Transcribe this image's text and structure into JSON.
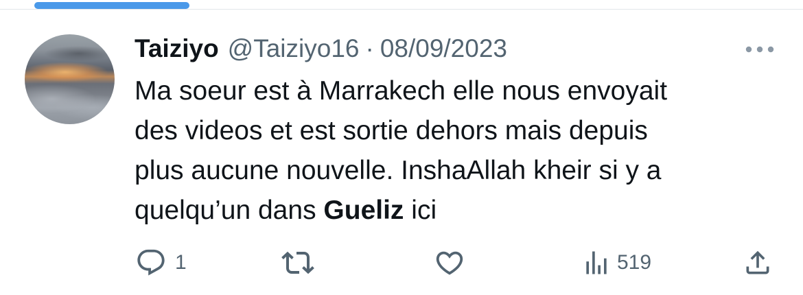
{
  "tweet": {
    "display_name": "Taiziyo",
    "handle": "@Taiziyo16",
    "separator": "·",
    "date": "08/09/2023",
    "text": {
      "line1": "Ma soeur est à Marrakech elle nous envoyait",
      "line2": "des videos et est sortie dehors mais depuis",
      "line3": "plus aucune nouvelle. InshaAllah kheir si y a",
      "line4_before": "quelqu’un dans ",
      "line4_bold": "Gueliz",
      "line4_after": " ici"
    }
  },
  "actions": {
    "reply_count": "1",
    "views_count": "519"
  },
  "icons": {
    "more": "more-horizontal-icon",
    "reply": "reply-icon",
    "retweet": "retweet-icon",
    "like": "heart-icon",
    "views": "views-icon",
    "share": "share-icon"
  },
  "colors": {
    "text_primary": "#0f1419",
    "text_secondary": "#536471",
    "accent": "#4a99e9"
  }
}
